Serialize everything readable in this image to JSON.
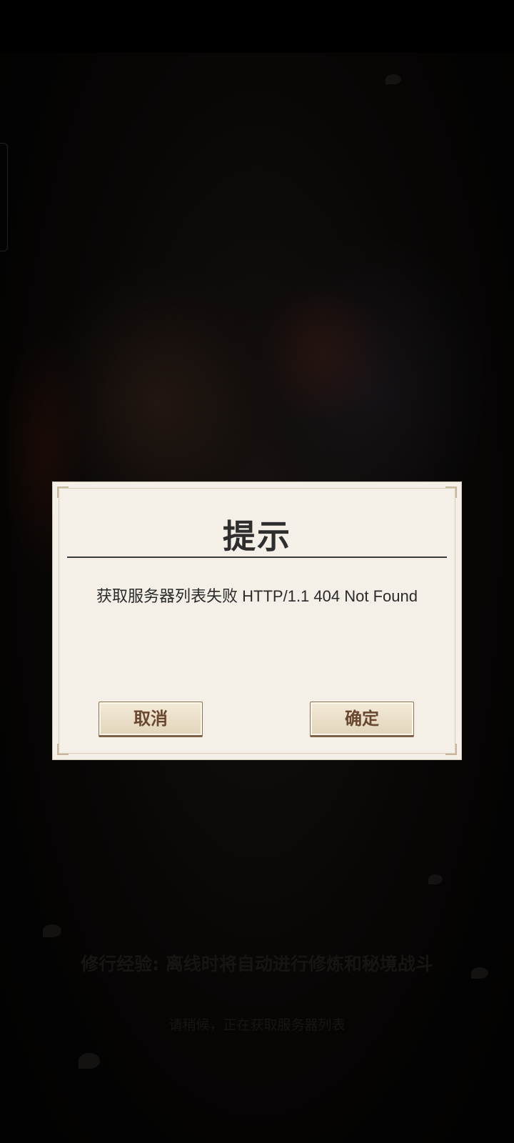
{
  "dialog": {
    "title": "提示",
    "message": "获取服务器列表失败 HTTP/1.1 404 Not Found",
    "cancel_label": "取消",
    "confirm_label": "确定"
  },
  "background": {
    "tip_text": "修行经验: 离线时将自动进行修炼和秘境战斗",
    "loading_text": "请稍候，正在获取服务器列表"
  },
  "colors": {
    "dialog_bg": "#f4f0e8",
    "button_text": "#6a4830",
    "title_text": "#2e2e2e"
  }
}
